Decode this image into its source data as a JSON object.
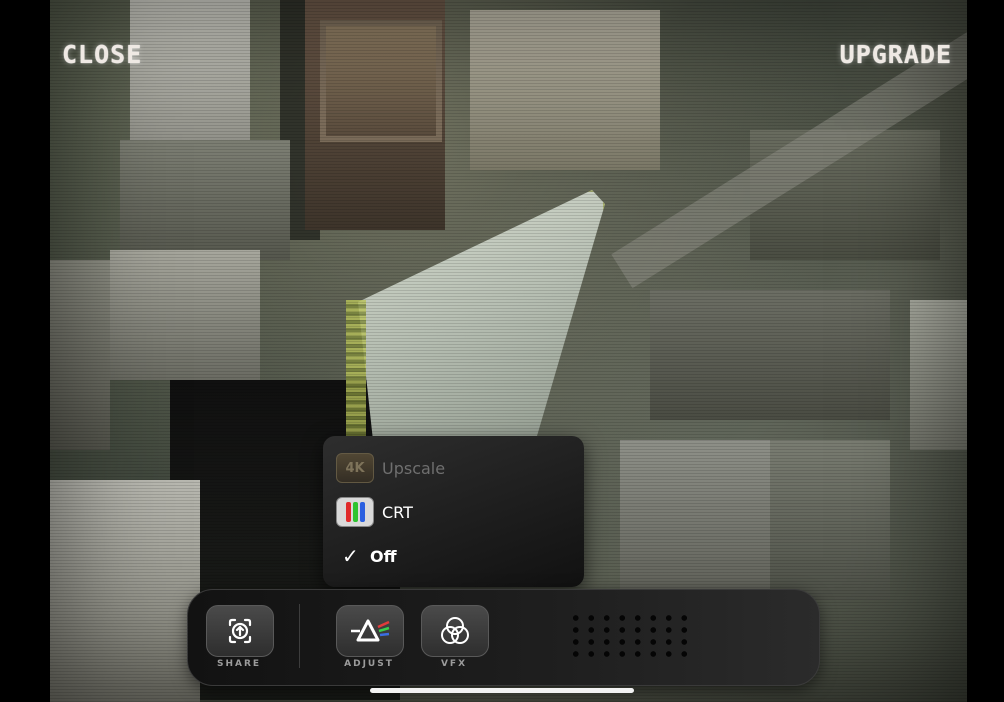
{
  "header": {
    "close_label": "CLOSE",
    "upgrade_label": "UPGRADE"
  },
  "filter_menu": {
    "items": [
      {
        "icon": "4k-icon",
        "label": "Upscale",
        "state": "disabled"
      },
      {
        "icon": "crt-icon",
        "label": "CRT",
        "state": "enabled"
      },
      {
        "icon": "checkmark-icon",
        "label": "Off",
        "state": "selected"
      }
    ],
    "upscale_badge": "4K"
  },
  "toolbar": {
    "share_label": "SHARE",
    "adjust_label": "ADJUST",
    "vfx_label": "VFX"
  },
  "colors": {
    "crt_bars": [
      "#e02a2a",
      "#2ec42e",
      "#2a5fe0"
    ],
    "label_text": "#efe9e4"
  }
}
